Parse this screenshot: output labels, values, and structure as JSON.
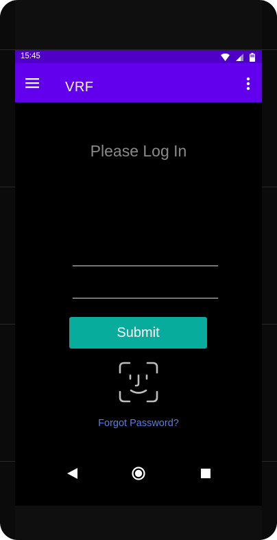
{
  "status_bar": {
    "time": "15:45",
    "icons": [
      "wifi-icon",
      "signal-icon",
      "battery-icon"
    ],
    "color": "#4f00c6"
  },
  "app_bar": {
    "title": "VRF",
    "menu_icon": "hamburger-menu-icon",
    "overflow_icon": "more-vert-icon",
    "color": "#6200ee"
  },
  "login": {
    "heading": "Please Log In",
    "username_value": "",
    "password_value": "",
    "submit_label": "Submit",
    "submit_color": "#08ac9c",
    "face_id_icon": "face-id-icon",
    "forgot_password_label": "Forgot Password?",
    "link_color": "#5b7fe0"
  },
  "navigation": {
    "buttons": [
      "back-icon",
      "home-icon",
      "recents-icon"
    ]
  }
}
